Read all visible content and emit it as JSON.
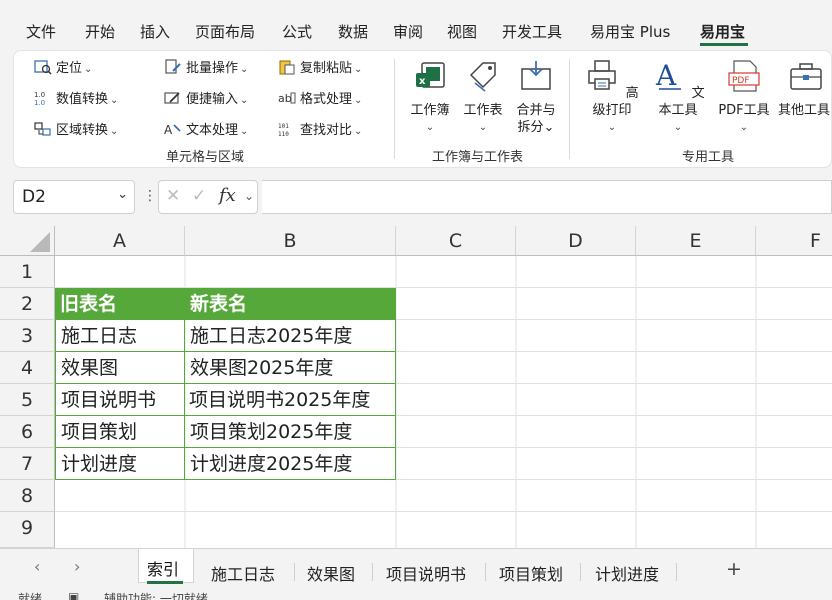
{
  "menu": {
    "tabs": [
      "文件",
      "开始",
      "插入",
      "页面布局",
      "公式",
      "数据",
      "审阅",
      "视图",
      "开发工具",
      "易用宝 Plus",
      "易用宝"
    ],
    "active": "易用宝"
  },
  "ribbon": {
    "cell_group": {
      "label": "单元格与区域",
      "items": [
        "定位",
        "批量操作",
        "复制粘贴",
        "数值转换",
        "便捷输入",
        "格式处理",
        "区域转换",
        "文本处理",
        "查找对比"
      ]
    },
    "workbook_group": {
      "label": "工作簿与工作表",
      "buttons": [
        "工作簿",
        "工作表",
        "合并与",
        "拆分"
      ]
    },
    "tools_group": {
      "label": "专用工具",
      "buttons": [
        "高级打印",
        "文本工具",
        "PDF工具",
        "其他工具"
      ]
    },
    "pdf_icon_text": "PDF"
  },
  "formula_bar": {
    "name_box": "D2",
    "fx": "fx",
    "value": ""
  },
  "grid": {
    "columns": [
      "A",
      "B",
      "C",
      "D",
      "E",
      "F"
    ],
    "rows": [
      "1",
      "2",
      "3",
      "4",
      "5",
      "6",
      "7",
      "8",
      "9"
    ],
    "table": {
      "header": [
        "旧表名",
        "新表名"
      ],
      "rows": [
        [
          "施工日志",
          "施工日志2025年度"
        ],
        [
          "效果图",
          "效果图2025年度"
        ],
        [
          "项目说明书",
          "项目说明书2025年度"
        ],
        [
          "项目策划",
          "项目策划2025年度"
        ],
        [
          "计划进度",
          "计划进度2025年度"
        ]
      ]
    },
    "header_color": "#56a83a"
  },
  "sheets": {
    "tabs": [
      "索引",
      "施工日志",
      "效果图",
      "项目说明书",
      "项目策划",
      "计划进度"
    ],
    "active": "索引",
    "add": "+"
  },
  "status": {
    "items": [
      "就绪",
      "辅助功能: 一切就绪"
    ]
  },
  "colors": {
    "accent": "#217346"
  }
}
